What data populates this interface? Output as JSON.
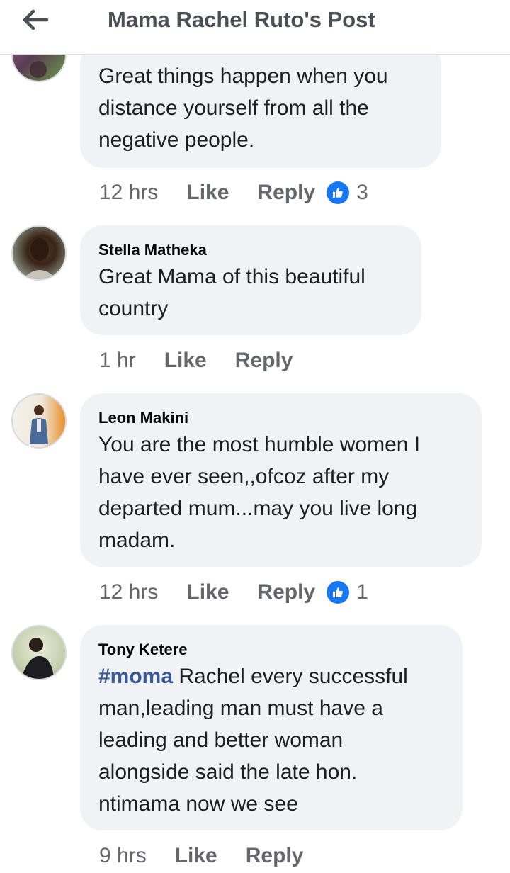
{
  "header": {
    "title": "Mama Rachel Ruto's Post",
    "back_icon": "arrow-left-icon"
  },
  "colors": {
    "like_blue": "#1877f2",
    "bubble_bg": "#f0f2f5",
    "hashtag": "#385898"
  },
  "comments": [
    {
      "name": "",
      "lines": [
        "Great things happen when you",
        "distance yourself from all the",
        "negative people."
      ],
      "time": "12 hrs",
      "like": "Like",
      "reply": "Reply",
      "reactions": "3"
    },
    {
      "name": "Stella Matheka",
      "lines": [
        "Great Mama of this beautiful",
        "country"
      ],
      "time": "1 hr",
      "like": "Like",
      "reply": "Reply"
    },
    {
      "name": "Leon Makini",
      "lines": [
        "You are the most humble women I",
        "have ever seen,,ofcoz after my",
        "departed mum...may you live long",
        "madam."
      ],
      "time": "12 hrs",
      "like": "Like",
      "reply": "Reply",
      "reactions": "1"
    },
    {
      "name": "Tony Ketere",
      "hashtag": "#moma",
      "first_line_rest": " Rachel every successful",
      "lines": [
        "man,leading man must have a",
        "leading and better woman",
        "alongside said the late hon.",
        "ntimama now we see"
      ],
      "time": "9 hrs",
      "like": "Like",
      "reply": "Reply"
    }
  ]
}
